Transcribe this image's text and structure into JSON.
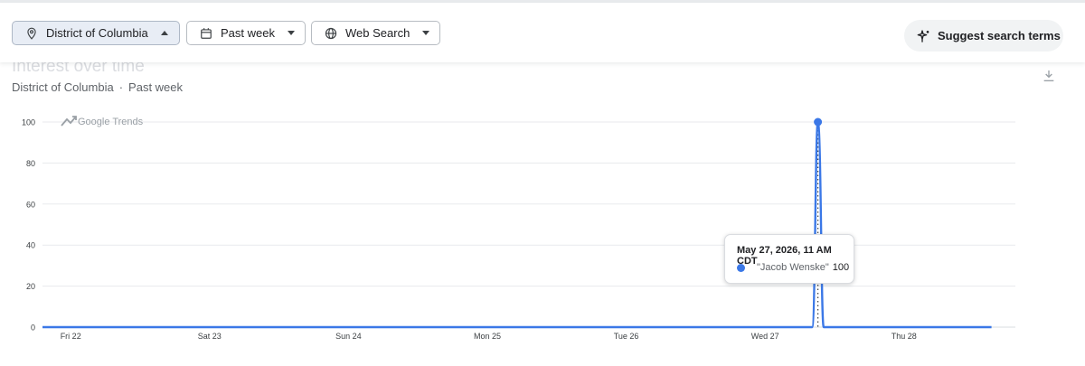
{
  "filters": {
    "location": "District of Columbia",
    "time_range": "Past week",
    "search_type": "Web Search"
  },
  "suggest_label": "Suggest search terms",
  "card": {
    "title": "Interest over time",
    "subtitle_region": "District of Columbia",
    "subtitle_separator": "·",
    "subtitle_period": "Past week",
    "watermark": "Google Trends"
  },
  "tooltip": {
    "date": "May 27, 2026, 11 AM CDT",
    "term": "\"Jacob Wenske\"",
    "value": "100"
  },
  "colors": {
    "series": "#3b78e7",
    "grid": "#e8eaed"
  },
  "chart_data": {
    "type": "line",
    "title": "",
    "xlabel": "",
    "ylabel": "",
    "ylim": [
      0,
      100
    ],
    "yticks": [
      0,
      20,
      40,
      60,
      80,
      100
    ],
    "xtick_labels": [
      "Fri 22",
      "Sat 23",
      "Sun 24",
      "Mon 25",
      "Tue 26",
      "Wed 27",
      "Thu 28"
    ],
    "x_unit": "hour",
    "x_start": "2026-05-21 21:00",
    "series": [
      {
        "name": "\"Jacob Wenske\"",
        "points": [
          {
            "x": "2026-05-21 21:00",
            "y": 0
          },
          {
            "x": "2026-05-27 10:00",
            "y": 0
          },
          {
            "x": "2026-05-27 11:00",
            "y": 100
          },
          {
            "x": "2026-05-27 12:00",
            "y": 0
          },
          {
            "x": "2026-05-28 17:00",
            "y": 0
          }
        ]
      }
    ],
    "highlight": {
      "x": "2026-05-27 11:00",
      "y": 100
    }
  }
}
